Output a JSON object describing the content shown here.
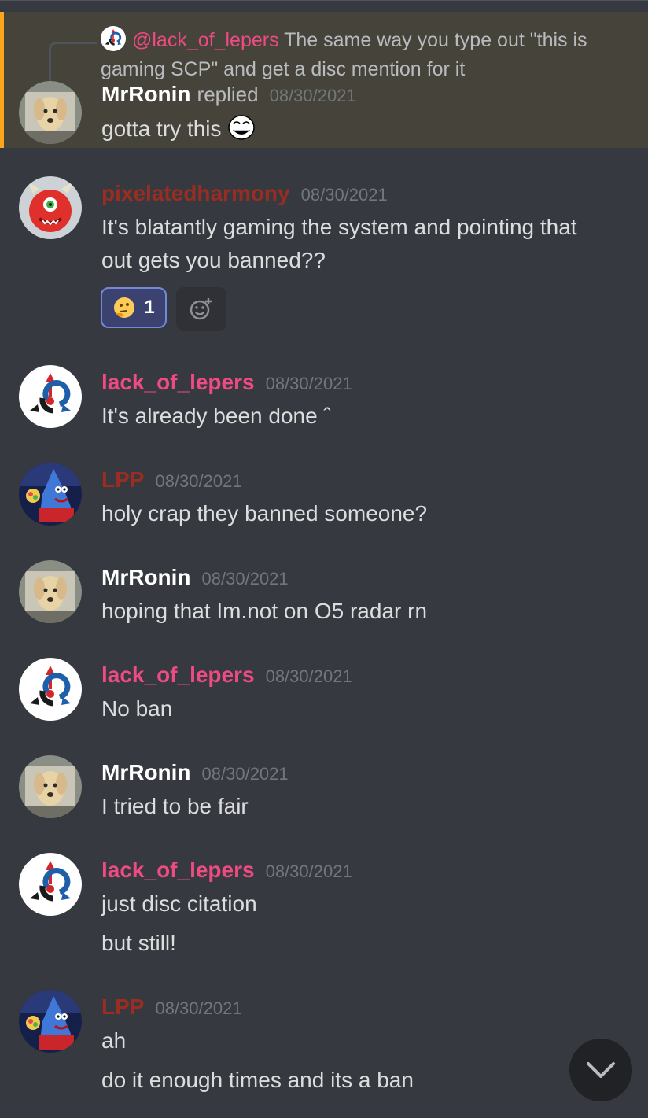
{
  "colors": {
    "background": "#36393f",
    "highlight": "#46433b",
    "highlight_bar": "#faa61a",
    "name_white": "#ffffff",
    "name_pink": "#ed4b82",
    "name_red": "#992d22",
    "timestamp": "#72767d",
    "text": "#dcddde"
  },
  "reply": {
    "mention": "@lack_of_lepers",
    "text": "The same way you type out \"this is gaming SCP\" and get a disc mention for it",
    "replied_label": "replied"
  },
  "messages": [
    {
      "author": "MrRonin",
      "timestamp": "08/30/2021",
      "lines": [
        "gotta try this"
      ],
      "avatar_icon": "dog-avatar-icon"
    },
    {
      "author": "pixelatedharmony",
      "timestamp": "08/30/2021",
      "lines": [
        "It's blatantly gaming the system and pointing that",
        "out gets you banned??"
      ],
      "avatar_icon": "red-monster-avatar-icon"
    },
    {
      "author": "lack_of_lepers",
      "timestamp": "08/30/2021",
      "lines": [
        "It's already been done ˆ"
      ],
      "avatar_icon": "scp-logo-avatar-icon"
    },
    {
      "author": "LPP",
      "timestamp": "08/30/2021",
      "lines": [
        "holy crap they banned someone?"
      ],
      "avatar_icon": "patrick-avatar-icon"
    },
    {
      "author": "MrRonin",
      "timestamp": "08/30/2021",
      "lines": [
        "hoping that Im.not on O5 radar rn"
      ],
      "avatar_icon": "dog-avatar-icon"
    },
    {
      "author": "lack_of_lepers",
      "timestamp": "08/30/2021",
      "lines": [
        "No ban"
      ],
      "avatar_icon": "scp-logo-avatar-icon"
    },
    {
      "author": "MrRonin",
      "timestamp": "08/30/2021",
      "lines": [
        "I tried to be fair"
      ],
      "avatar_icon": "dog-avatar-icon"
    },
    {
      "author": "lack_of_lepers",
      "timestamp": "08/30/2021",
      "lines": [
        "just disc citation",
        "but still!"
      ],
      "avatar_icon": "scp-logo-avatar-icon"
    },
    {
      "author": "LPP",
      "timestamp": "08/30/2021",
      "lines": [
        "ah",
        "do it enough times and its a ban"
      ],
      "avatar_icon": "patrick-avatar-icon"
    }
  ],
  "reaction": {
    "emoji_icon": "thinking-emoji-icon",
    "count": "1"
  },
  "icons": {
    "add_reaction": "add-reaction-icon",
    "scroll_down": "chevron-down-icon",
    "inline_emoji": "trollface-emoji-icon"
  }
}
